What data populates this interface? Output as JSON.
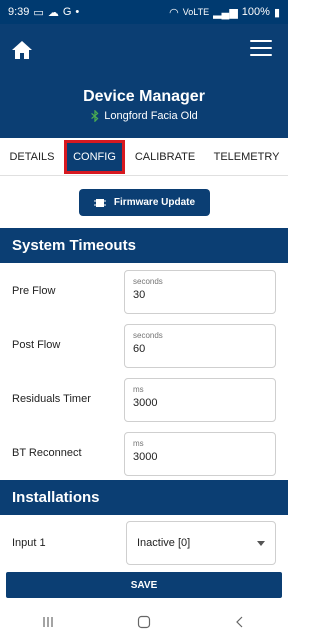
{
  "status": {
    "time": "9:39",
    "battery": "100%",
    "network": "VoLTE"
  },
  "header": {
    "title": "Device Manager",
    "subtitle": "Longford Facia Old"
  },
  "tabs": [
    {
      "label": "DETAILS"
    },
    {
      "label": "CONFIG"
    },
    {
      "label": "CALIBRATE"
    },
    {
      "label": "TELEMETRY"
    }
  ],
  "firmware_button": {
    "label": "Firmware Update"
  },
  "timeouts": {
    "title": "System Timeouts",
    "rows": [
      {
        "label": "Pre Flow",
        "unit": "seconds",
        "value": "30"
      },
      {
        "label": "Post Flow",
        "unit": "seconds",
        "value": "60"
      },
      {
        "label": "Residuals Timer",
        "unit": "ms",
        "value": "3000"
      },
      {
        "label": "BT Reconnect",
        "unit": "ms",
        "value": "3000"
      }
    ]
  },
  "installations": {
    "title": "Installations",
    "input1": {
      "label": "Input 1",
      "value": "Inactive [0]"
    }
  },
  "save_label": "SAVE",
  "colors": {
    "primary": "#0b3e73",
    "active_tab_border": "#d71920",
    "bluetooth": "#4caf50"
  }
}
